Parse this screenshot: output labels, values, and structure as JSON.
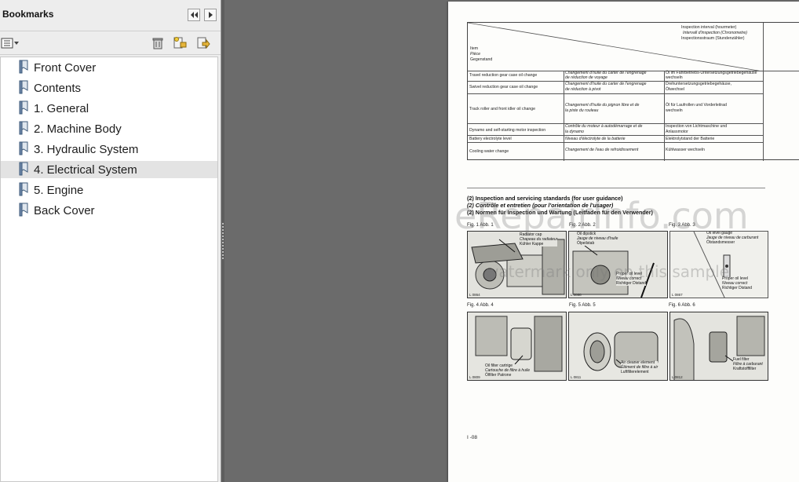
{
  "bookmarks": {
    "title": "Bookmarks",
    "items": [
      {
        "label": "Front Cover"
      },
      {
        "label": "Contents"
      },
      {
        "label": "1. General"
      },
      {
        "label": "2. Machine Body"
      },
      {
        "label": "3. Hydraulic System"
      },
      {
        "label": "4. Electrical System",
        "selected": true
      },
      {
        "label": "5. Engine"
      },
      {
        "label": "Back Cover"
      }
    ]
  },
  "icons": {
    "collapse": "double-left-arrow-icon",
    "expand": "right-arrow-icon",
    "options": "options-menu-icon",
    "delete": "trash-icon",
    "new_bookmark": "new-bookmark-icon",
    "goto": "goto-bookmark-icon",
    "bookmark": "bookmark-ribbon-icon"
  },
  "document": {
    "table": {
      "header_interval": [
        "Inspection interval (hourmeter)",
        "Intervall d'inspection (Chronometre)",
        "Inspectionsstraum (Stundenzähler)"
      ],
      "header_item": [
        "Item",
        "Pièce",
        "Gegenstand"
      ],
      "rows": [
        {
          "en": [
            "Travel reduction gear case oil change"
          ],
          "fr": [
            "Changement d'huile du carter de l'engrenage",
            "de réduction de voyage"
          ],
          "de": [
            "Öl im Fahrbetriebs-Untersetzungsgetriebegehäuse",
            "wechseln"
          ]
        },
        {
          "en": [
            "Swivel reduction gear case oil change"
          ],
          "fr": [
            "Changement d'huile du carter de l'engrenage",
            "de réduction à pivot"
          ],
          "de": [
            "Drehuntersetzungsgetriebegehäuse,",
            "Ölwechsel"
          ]
        },
        {
          "en": [
            "Track roller and front idler oil change"
          ],
          "fr": [
            "Changement d'huile du pignon libre et de",
            "la piste du rouleau"
          ],
          "de": [
            "Öl für Laufrollen und Vorderleitrad",
            "wechseln"
          ]
        },
        {
          "en": [
            "Dynamo and self-starting motor inspection"
          ],
          "fr": [
            "Contrôle du moteur à autodémarrage et de",
            "la dynamo"
          ],
          "de": [
            "Inspection von Lichtmaschine und",
            "Anlassmotor"
          ]
        },
        {
          "en": [
            "Battery electrolyte level"
          ],
          "fr": [
            "Niveau d'électrolyte de la batterie"
          ],
          "de": [
            "Elektrolytstand der Batterie"
          ]
        },
        {
          "en": [
            "Cooling water change"
          ],
          "fr": [
            "Changement de l'eau de refroidissement"
          ],
          "de": [
            "Kühlwasser wechseln"
          ]
        }
      ]
    },
    "standards": [
      "(2)  Inspection and servicing standards (for user guidance)",
      "(2)  Contrôle et entretien (pour l'orientation de l'usager)",
      "(2)  Normen für Inspection und Wartung (Leitfaden für den Verwender)"
    ],
    "figures": [
      {
        "label": "Fig. 1   Abb. 1",
        "code": "L 0864",
        "callout": [
          "Radiator cap",
          "Chapeau du radiateur",
          "Kühler Kappe"
        ]
      },
      {
        "label": "Fig. 2   Abb. 2",
        "code": "L 0868",
        "callout": [
          "Oil dipstick",
          "Jauge de niveau d'huile",
          "Ölpeilstab"
        ],
        "callout2": [
          "Proper oil level",
          "Niveau correct",
          "Richtiger Distand"
        ]
      },
      {
        "label": "Fig. 3   Abb. 3",
        "code": "L 0867",
        "callout": [
          "Oil level gauge",
          "Jauge de niveau de carburant",
          "Ölstandsmesser"
        ],
        "callout2": [
          "Proper oil level",
          "Niveau correct",
          "Richtiger Distand"
        ]
      },
      {
        "label": "Fig. 4   Abb. 4",
        "code": "L 0809",
        "callout": [
          "Oil filter cartrige",
          "Cartouche de filtre à huile",
          "Ölfilter Patrone"
        ]
      },
      {
        "label": "Fig. 5   Abb. 5",
        "code": "L 0811",
        "callout": [
          "Air cleaner element",
          "Élément de filtre à air",
          "Luftfilterelement"
        ]
      },
      {
        "label": "Fig. 6   Abb. 6",
        "code": "L 0812",
        "callout": [
          "Fuel filter",
          "Filtre à carburant",
          "Kraftstofffilter"
        ]
      }
    ],
    "watermark_main": "eRepairInfo.com",
    "watermark_sub": "watermark only on this sample",
    "page_number": "I -08"
  }
}
